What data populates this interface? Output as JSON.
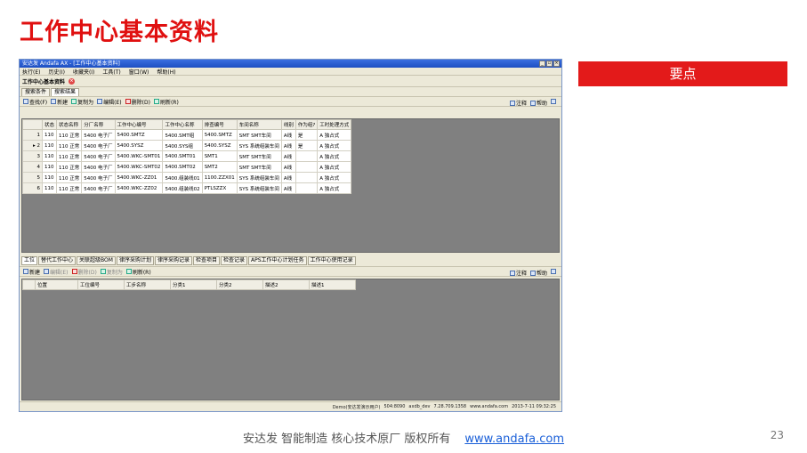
{
  "slide": {
    "title": "工作中心基本资料",
    "keypoint_label": "要点",
    "footer_text": "安达发  智能制造 核心技术原厂  版权所有",
    "footer_link": "www.andafa.com",
    "page_number": "23"
  },
  "window": {
    "title": "安达发 Andafa AX - [工作中心基本资料]",
    "controls": [
      "_",
      "▫",
      "×"
    ],
    "menu": [
      "执行(E)",
      "历史(I)",
      "收藏夹(I)",
      "工具(T)",
      "窗口(W)",
      "帮助(H)"
    ],
    "document_tab": "工作中心基本资料",
    "subtabs": [
      "搜索条件",
      "搜索结果"
    ],
    "toolbar": [
      "查找(F)",
      "新建",
      "复制为",
      "编辑(E)",
      "删除(D)",
      "刷新(R)"
    ],
    "toolbar_right": [
      "注释",
      "帮助"
    ],
    "grid": {
      "columns": [
        "状态",
        "状态名称",
        "分厂名称",
        "工作中心编号",
        "工作中心名称",
        "排查编号",
        "车间名称",
        "线别",
        "作为组?",
        "工时处理方式"
      ],
      "rows": [
        [
          "1",
          "110",
          "110 正常",
          "5400 电子厂",
          "5400.SMTZ",
          "5400.SMT组",
          "5400.SMTZ",
          "SMT SMT车间",
          "A线",
          "是",
          "A 独占式"
        ],
        [
          "2",
          "110",
          "110 正常",
          "5400 电子厂",
          "5400.SYSZ",
          "5400.SYS组",
          "5400.SYSZ",
          "SYS 系统组装车间",
          "A线",
          "是",
          "A 独占式"
        ],
        [
          "3",
          "110",
          "110 正常",
          "5400 电子厂",
          "5400.WKC-SMT01",
          "5400.SMT01",
          "SMT1",
          "SMT SMT车间",
          "A线",
          "",
          "A 独占式"
        ],
        [
          "4",
          "110",
          "110 正常",
          "5400 电子厂",
          "5400.WKC-SMT02",
          "5400.SMT02",
          "SMT2",
          "SMT SMT车间",
          "A线",
          "",
          "A 独占式"
        ],
        [
          "5",
          "110",
          "110 正常",
          "5400 电子厂",
          "5400.WKC-ZZ01",
          "5400.组装线01",
          "1100.ZZX01",
          "SYS 系统组装车间",
          "A线",
          "",
          "A 独占式"
        ],
        [
          "6",
          "110",
          "110 正常",
          "5400 电子厂",
          "5400.WKC-ZZ02",
          "5400.组装线02",
          "PTLSZZX",
          "SYS 系统组装车间",
          "A线",
          "",
          "A 独占式"
        ]
      ],
      "current_row_marker": "▸"
    },
    "bottom_tabs": [
      "工位",
      "替代工作中心",
      "关联超级BOM",
      "律序采购计划",
      "律序采购记录",
      "检查项目",
      "检查记录",
      "APS工作中心计划任务",
      "工作中心使用记录"
    ],
    "bottom_toolbar": [
      "新建",
      "编辑(E)",
      "删除(D)",
      "复制为",
      "刷新(R)"
    ],
    "bottom_grid_columns": [
      "位置",
      "工位编号",
      "工步名称",
      "分类1",
      "分类2",
      "描述2",
      "描述1"
    ],
    "status": [
      "Demo(安达发演示用户)",
      "504:8090",
      "axdb_dev",
      "7.28.709.1358",
      "www.andafa.com",
      "2013-7-11 09:32:25"
    ]
  },
  "colors": {
    "accent_red": "#e31a1a",
    "title_red": "#e01010"
  }
}
